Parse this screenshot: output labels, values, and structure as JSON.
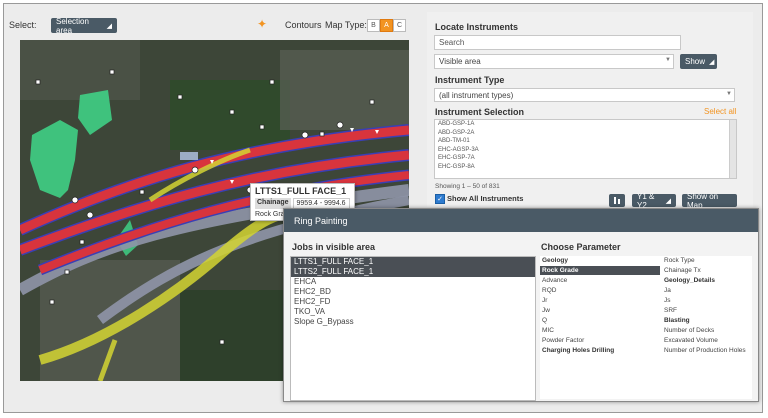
{
  "toolbar": {
    "select_label": "Select:",
    "selection_button": "Selection area",
    "contours_label": "Contours",
    "map_type_label": "Map Type:",
    "map_types": [
      "B",
      "A",
      "C"
    ],
    "active_map_type": "A",
    "accent_color": "#f29422"
  },
  "map": {
    "tooltip": {
      "title": "LTTS1_FULL FACE_1",
      "chainage_label": "Chainage",
      "chainage_value": "9959.4 - 9994.6",
      "rock_grade_label": "Rock Grad"
    }
  },
  "locate": {
    "heading": "Locate Instruments",
    "search_value": "Search",
    "area_select": "Visible area",
    "show_button": "Show"
  },
  "instrument_type": {
    "heading": "Instrument Type",
    "select_value": "(all instrument types)"
  },
  "instrument_selection": {
    "heading": "Instrument Selection",
    "select_all": "Select all",
    "items": [
      "ABD-GSP-1A",
      "ABD-GSP-2A",
      "ABD-TM-01",
      "EHC-AGSP-3A",
      "EHC-GSP-7A",
      "EHC-GSP-8A"
    ],
    "count_text": "Showing 1 – 50 of 831",
    "show_all_label": "Show All Instruments",
    "y_button": "Y1 & Y2",
    "show_on_map_button": "Show on Map"
  },
  "dialog": {
    "title": "Ring Painting",
    "jobs_heading": "Jobs in visible area",
    "jobs": [
      "LTTS1_FULL FACE_1",
      "LTTS2_FULL FACE_1",
      "EHCA",
      "EHC2_BD",
      "EHC2_FD",
      "TKO_VA",
      "Slope G_Bypass"
    ],
    "selected_jobs": [
      0,
      1
    ],
    "params_heading": "Choose Parameter",
    "params_left": [
      "Geology",
      "Rock Grade",
      "Advance",
      "RQD",
      "Jr",
      "Jw",
      "Q",
      "MIC",
      "Powder Factor",
      "Charging Holes Drilling"
    ],
    "params_right": [
      "Rock Type",
      "Chainage Tx",
      "Geology_Details",
      "Ja",
      "Js",
      "SRF",
      "Blasting",
      "Number of Decks",
      "Excavated Volume",
      "Number of Production Holes"
    ],
    "selected_param": "Rock Grade",
    "bold_params": [
      "Geology",
      "Geology_Details",
      "Blasting",
      "Charging Holes Drilling"
    ]
  }
}
